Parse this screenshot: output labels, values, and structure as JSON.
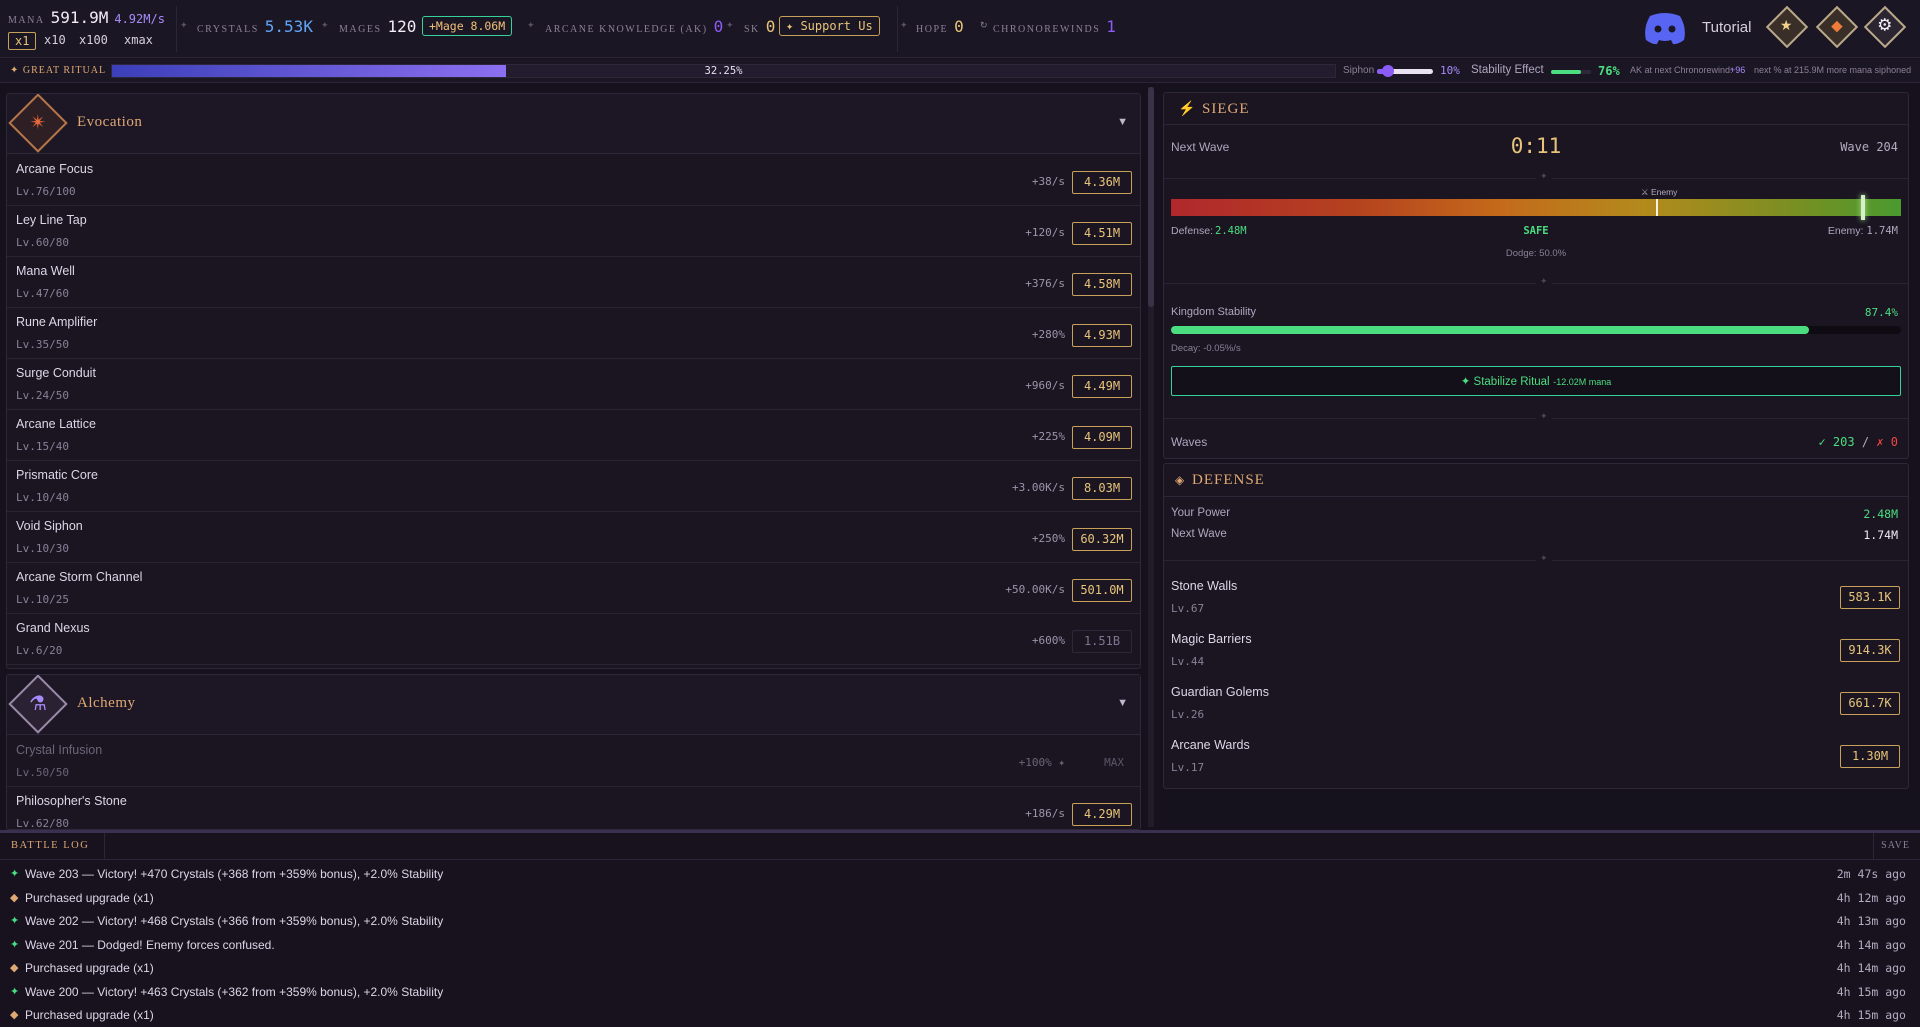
{
  "topbar": {
    "mana_label": "MANA",
    "mana_value": "591.9M",
    "mana_rate": "4.92M/s",
    "multipliers": [
      "x1",
      "x10",
      "x100",
      "xmax"
    ],
    "crystals_label": "CRYSTALS",
    "crystals_value": "5.53K",
    "mages_label": "MAGES",
    "mages_value": "120",
    "mage_button": "+Mage 8.06M",
    "ak_label": "ARCANE KNOWLEDGE (AK)",
    "ak_value": "0",
    "sk_label": "SK",
    "sk_value": "0",
    "support_button": "✦ Support Us",
    "hope_label": "HOPE",
    "hope_value": "0",
    "chrono_label": "CHRONOREWINDS",
    "chrono_value": "1",
    "tutorial_label": "Tutorial",
    "icons": [
      "discord-icon",
      "rank-badge-icon",
      "faction-shield-icon",
      "gear-icon"
    ]
  },
  "ritual": {
    "label": "✦ GREAT RITUAL",
    "progress_text": "32.25%",
    "progress": 0.3225,
    "siphon_label": "Siphon",
    "siphon_value": "10%",
    "siphon_level": 0.2,
    "stability_label": "Stability Effect",
    "stability_value": "76%",
    "stability_level": 0.76,
    "ak_note_prefix": "AK at next Chronorewind:",
    "ak_note_value": "+96",
    "next_note": "next % at 215.9M more mana siphoned"
  },
  "evocation": {
    "title": "Evocation",
    "upgrades": [
      {
        "name": "Arcane Focus",
        "level": "Lv.76/100",
        "rate": "+38/s",
        "cost": "4.36M"
      },
      {
        "name": "Ley Line Tap",
        "level": "Lv.60/80",
        "rate": "+120/s",
        "cost": "4.51M"
      },
      {
        "name": "Mana Well",
        "level": "Lv.47/60",
        "rate": "+376/s",
        "cost": "4.58M"
      },
      {
        "name": "Rune Amplifier",
        "level": "Lv.35/50",
        "rate": "+280%",
        "cost": "4.93M"
      },
      {
        "name": "Surge Conduit",
        "level": "Lv.24/50",
        "rate": "+960/s",
        "cost": "4.49M"
      },
      {
        "name": "Arcane Lattice",
        "level": "Lv.15/40",
        "rate": "+225%",
        "cost": "4.09M"
      },
      {
        "name": "Prismatic Core",
        "level": "Lv.10/40",
        "rate": "+3.00K/s",
        "cost": "8.03M"
      },
      {
        "name": "Void Siphon",
        "level": "Lv.10/30",
        "rate": "+250%",
        "cost": "60.32M"
      },
      {
        "name": "Arcane Storm Channel",
        "level": "Lv.10/25",
        "rate": "+50.00K/s",
        "cost": "501.0M"
      },
      {
        "name": "Grand Nexus",
        "level": "Lv.6/20",
        "rate": "+600%",
        "cost": "1.51B"
      }
    ]
  },
  "alchemy": {
    "title": "Alchemy",
    "upgrades": [
      {
        "name": "Crystal Infusion",
        "level": "Lv.50/50",
        "rate": "+100% ✦",
        "cost": "MAX"
      },
      {
        "name": "Philosopher's Stone",
        "level": "Lv.62/80",
        "rate": "+186/s",
        "cost": "4.29M"
      }
    ]
  },
  "siege": {
    "title": "SIEGE",
    "next_wave_label": "Next Wave",
    "timer": "0:11",
    "wave_label": "Wave 204",
    "enemy_marker_label": "⚔ Enemy",
    "defense_label": "Defense:",
    "defense_value": "2.48M",
    "status": "SAFE",
    "enemy_label": "Enemy:",
    "enemy_value": "1.74M",
    "dodge_text": "Dodge: 50.0%",
    "stability_label": "Kingdom Stability",
    "stability_value": "87.4%",
    "stability_level": 0.874,
    "decay_text": "Decay: -0.05%/s",
    "stabilize_label": "✦ Stabilize Ritual",
    "stabilize_cost": "-12.02M mana",
    "waves_label": "Waves",
    "waves_won": "✓ 203",
    "waves_slash": "/",
    "waves_lost": "✗ 0"
  },
  "defense": {
    "title": "DEFENSE",
    "power_label": "Your Power",
    "power_value": "2.48M",
    "next_label": "Next Wave",
    "next_value": "1.74M",
    "items": [
      {
        "name": "Stone Walls",
        "level": "Lv.67",
        "cost": "583.1K"
      },
      {
        "name": "Magic Barriers",
        "level": "Lv.44",
        "cost": "914.3K"
      },
      {
        "name": "Guardian Golems",
        "level": "Lv.26",
        "cost": "661.7K"
      },
      {
        "name": "Arcane Wards",
        "level": "Lv.17",
        "cost": "1.30M"
      }
    ]
  },
  "battle_log": {
    "title": "BATTLE LOG",
    "save_label": "SAVE",
    "entries": [
      {
        "kind": "victory",
        "text": "Wave 203 — Victory! +470 Crystals (+368 from +359% bonus), +2.0% Stability",
        "time": "2m 47s ago"
      },
      {
        "kind": "purchase",
        "text": "Purchased upgrade (x1)",
        "time": "4h 12m ago"
      },
      {
        "kind": "victory",
        "text": "Wave 202 — Victory! +468 Crystals (+366 from +359% bonus), +2.0% Stability",
        "time": "4h 13m ago"
      },
      {
        "kind": "victory",
        "text": "Wave 201 — Dodged! Enemy forces confused.",
        "time": "4h 14m ago"
      },
      {
        "kind": "purchase",
        "text": "Purchased upgrade (x1)",
        "time": "4h 14m ago"
      },
      {
        "kind": "victory",
        "text": "Wave 200 — Victory! +463 Crystals (+362 from +359% bonus), +2.0% Stability",
        "time": "4h 15m ago"
      },
      {
        "kind": "purchase",
        "text": "Purchased upgrade (x1)",
        "time": "4h 15m ago"
      }
    ]
  }
}
